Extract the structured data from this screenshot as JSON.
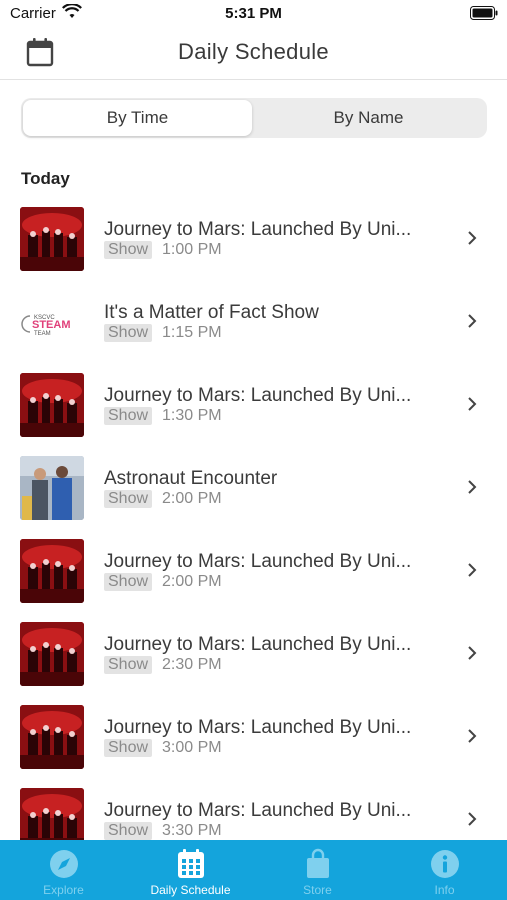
{
  "status_bar": {
    "carrier": "Carrier",
    "time": "5:31 PM"
  },
  "nav": {
    "title": "Daily Schedule"
  },
  "segment": {
    "options": [
      "By Time",
      "By Name"
    ],
    "selected": "By Time"
  },
  "section": {
    "header": "Today"
  },
  "events": [
    {
      "title": "Journey to Mars: Launched By Uni...",
      "tag": "Show",
      "time": "1:00 PM",
      "thumb": "mars"
    },
    {
      "title": "It's a Matter of Fact Show",
      "tag": "Show",
      "time": "1:15 PM",
      "thumb": "steam"
    },
    {
      "title": "Journey to Mars: Launched By Uni...",
      "tag": "Show",
      "time": "1:30 PM",
      "thumb": "mars"
    },
    {
      "title": "Astronaut Encounter",
      "tag": "Show",
      "time": "2:00 PM",
      "thumb": "astro"
    },
    {
      "title": "Journey to Mars: Launched By Uni...",
      "tag": "Show",
      "time": "2:00 PM",
      "thumb": "mars"
    },
    {
      "title": "Journey to Mars: Launched By Uni...",
      "tag": "Show",
      "time": "2:30 PM",
      "thumb": "mars"
    },
    {
      "title": "Journey to Mars: Launched By Uni...",
      "tag": "Show",
      "time": "3:00 PM",
      "thumb": "mars"
    },
    {
      "title": "Journey to Mars: Launched By Uni...",
      "tag": "Show",
      "time": "3:30 PM",
      "thumb": "mars"
    }
  ],
  "steam_logo": {
    "top": "KSCVC",
    "main": "STEAM",
    "sub": "TEAM"
  },
  "tabs": [
    {
      "label": "Explore",
      "icon": "compass-icon",
      "active": false
    },
    {
      "label": "Daily Schedule",
      "icon": "calendar-icon",
      "active": true
    },
    {
      "label": "Store",
      "icon": "shopping-bag-icon",
      "active": false
    },
    {
      "label": "Info",
      "icon": "info-icon",
      "active": false
    }
  ],
  "colors": {
    "accent": "#14a4dc",
    "tab_inactive": "#7fd0ee",
    "mars_red": "#c2181e"
  }
}
